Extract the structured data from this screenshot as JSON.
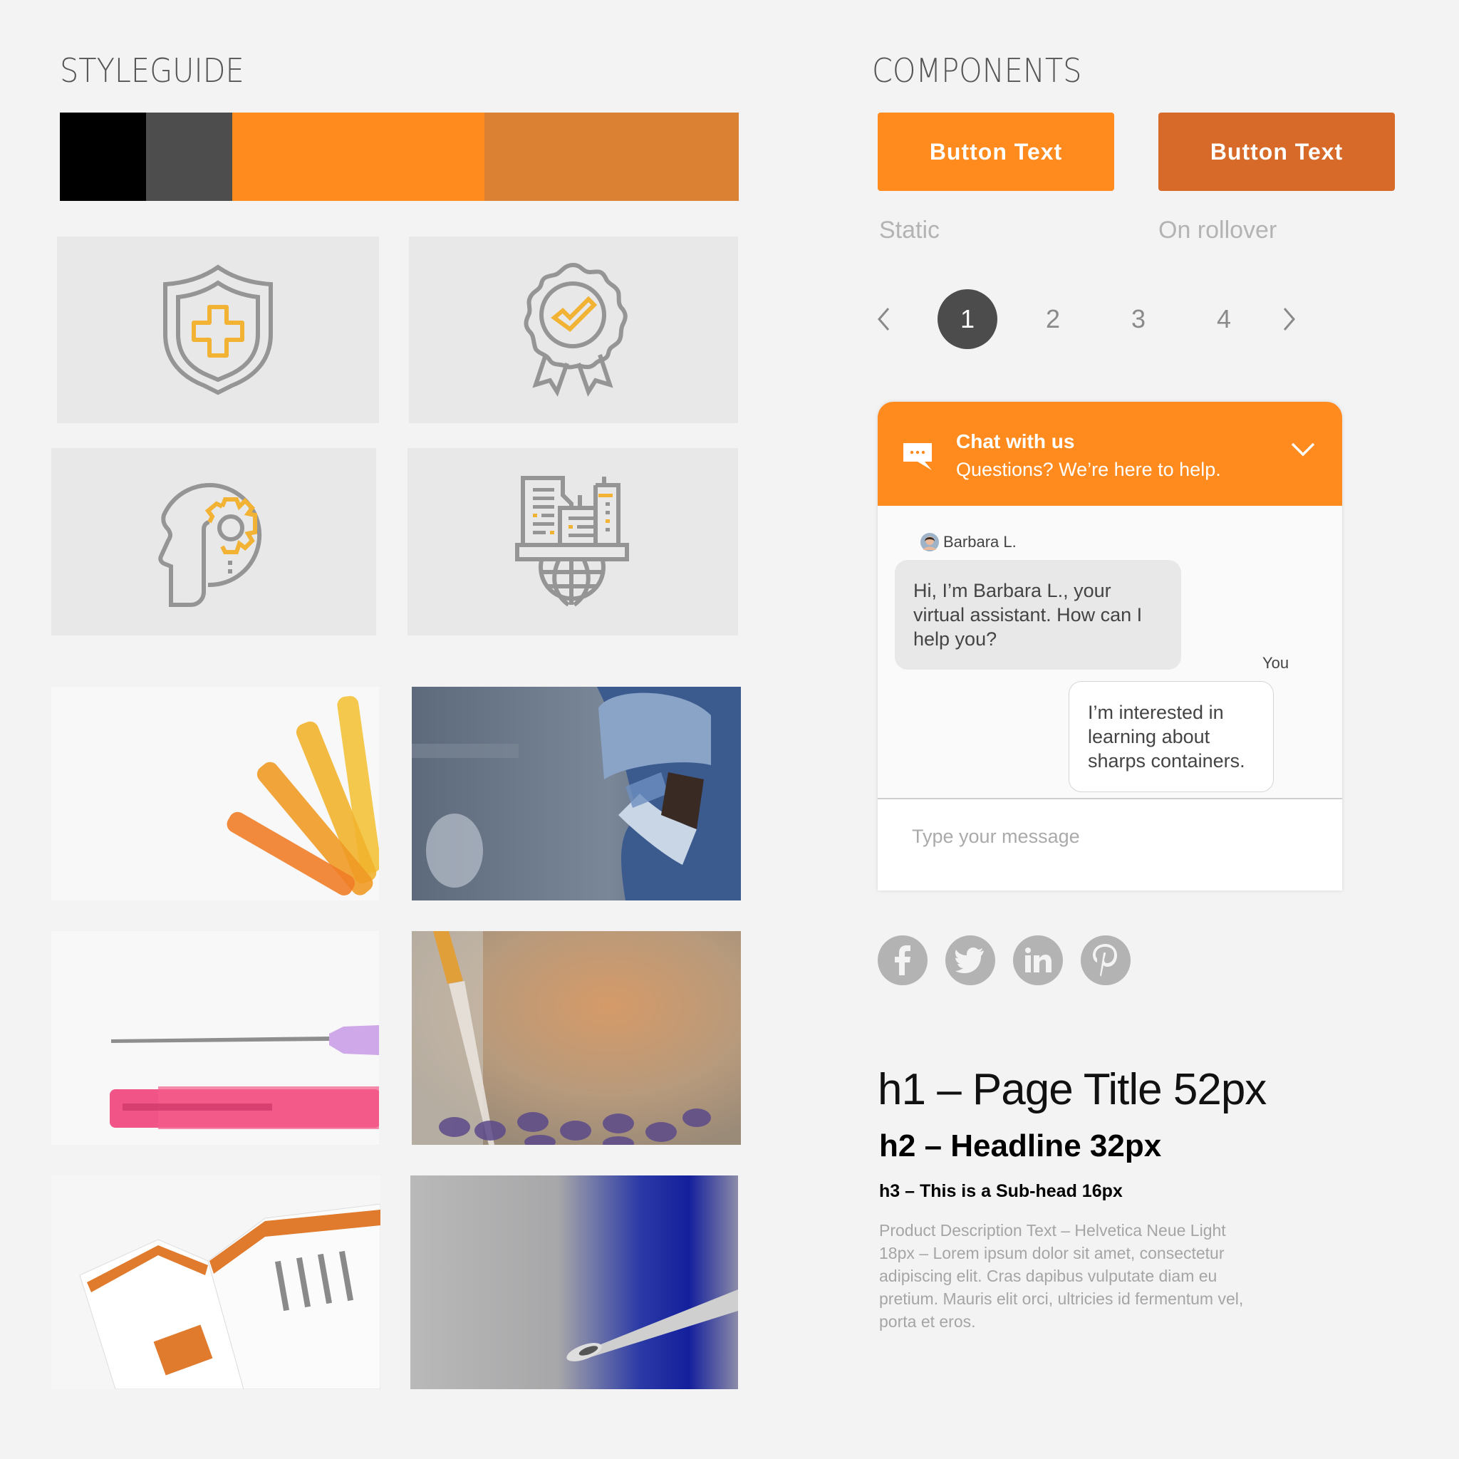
{
  "styleguide": {
    "title": "STYLEGUIDE",
    "palette": [
      {
        "name": "black",
        "color": "#000000",
        "share": 0.127
      },
      {
        "name": "dark-gray",
        "color": "#4d4d4d",
        "share": 0.127
      },
      {
        "name": "orange",
        "color": "#ff8a1e",
        "share": 0.371
      },
      {
        "name": "dark-orange",
        "color": "#da8133",
        "share": 0.375
      }
    ],
    "icon_colors": {
      "stroke": "#959595",
      "accent": "#f2b233"
    },
    "icons": [
      "shield-medical-icon",
      "award-check-icon",
      "head-gear-icon",
      "city-globe-icon"
    ],
    "photos": [
      "orange-safety-needles-photo",
      "surgeon-in-mask-photo",
      "pink-needle-and-cap-photo",
      "lab-pipette-photo",
      "product-brochure-photo",
      "needle-tip-on-blue-photo"
    ]
  },
  "components": {
    "title": "COMPONENTS",
    "buttons": [
      {
        "label": "Button Text",
        "state_label": "Static",
        "color": "#ff8a1e"
      },
      {
        "label": "Button Text",
        "state_label": "On rollover",
        "color": "#d76a29"
      }
    ],
    "pagination": {
      "pages": [
        "1",
        "2",
        "3",
        "4"
      ],
      "active_page": "1",
      "prev_icon": "chevron-left-icon",
      "next_icon": "chevron-right-icon"
    },
    "chat": {
      "title": "Chat with us",
      "subtitle": "Questions? We’re here to help.",
      "header_color": "#ff8a1e",
      "agent_name": "Barbara L.",
      "agent_message": "Hi, I’m Barbara L., your virtual assistant. How can I help you?",
      "user_name": "You",
      "user_message": "I’m interested in learning about sharps containers.",
      "input_placeholder": "Type your message"
    },
    "social": [
      "facebook-icon",
      "twitter-icon",
      "linkedin-icon",
      "pinterest-icon"
    ],
    "typography": {
      "h1": "h1 – Page Title 52px",
      "h2": "h2 – Headline 32px",
      "h3": "h3 – This is a Sub-head 16px",
      "body": "Product Description Text – Helvetica Neue Light 18px  – Lorem ipsum dolor sit amet, consectetur adipiscing elit. Cras dapibus vulputate diam eu pretium. Mauris elit orci, ultricies id fermentum vel, porta et eros."
    }
  }
}
